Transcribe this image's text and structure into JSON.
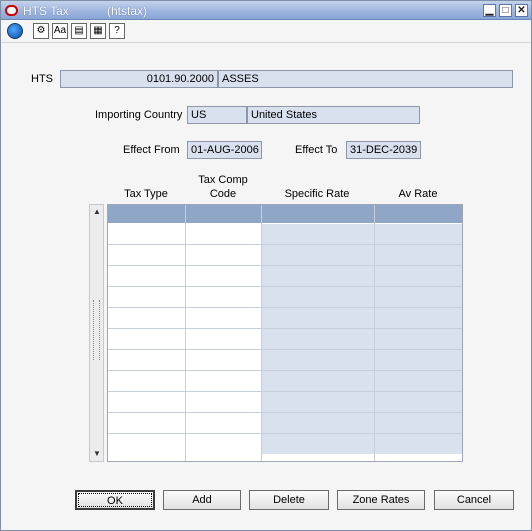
{
  "window": {
    "title": "HTS Tax",
    "form_name": "(htstax)",
    "min_label": "▁",
    "max_label": "□",
    "close_label": "✕"
  },
  "toolbar": {
    "btn2": "⚙",
    "btn3": "Aa",
    "btn4": "▤",
    "btn5": "▦",
    "btn6": "?"
  },
  "form": {
    "hts_label": "HTS",
    "hts_code": "0101.90.2000",
    "hts_desc": "ASSES",
    "country_label": "Importing Country",
    "country_code": "US",
    "country_name": "United States",
    "effect_from_label": "Effect From",
    "effect_from": "01-AUG-2006",
    "effect_to_label": "Effect To",
    "effect_to": "31-DEC-2039"
  },
  "grid": {
    "columns": [
      "Tax Type",
      "Tax Comp\nCode",
      "Specific Rate",
      "Av Rate"
    ],
    "col1": "Tax Type",
    "col2a": "Tax Comp",
    "col2b": "Code",
    "col3": "Specific Rate",
    "col4": "Av Rate"
  },
  "buttons": {
    "ok": "OK",
    "add": "Add",
    "delete": "Delete",
    "zone_rates": "Zone Rates",
    "cancel": "Cancel"
  }
}
